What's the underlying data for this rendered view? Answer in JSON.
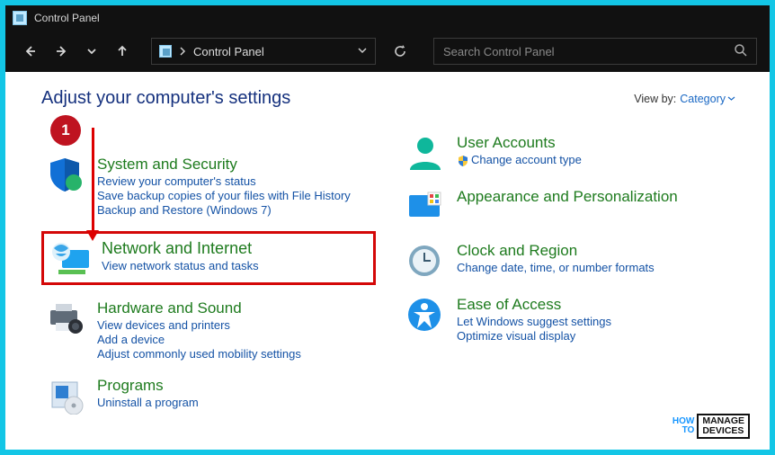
{
  "window": {
    "title": "Control Panel"
  },
  "breadcrumb": {
    "label": "Control Panel"
  },
  "search": {
    "placeholder": "Search Control Panel"
  },
  "heading": "Adjust your computer's settings",
  "viewby": {
    "label": "View by:",
    "value": "Category"
  },
  "step": {
    "badge": "1"
  },
  "left": [
    {
      "title": "System and Security",
      "links": [
        "Review your computer's status",
        "Save backup copies of your files with File History",
        "Backup and Restore (Windows 7)"
      ]
    },
    {
      "title": "Network and Internet",
      "links": [
        "View network status and tasks"
      ]
    },
    {
      "title": "Hardware and Sound",
      "links": [
        "View devices and printers",
        "Add a device",
        "Adjust commonly used mobility settings"
      ]
    },
    {
      "title": "Programs",
      "links": [
        "Uninstall a program"
      ]
    }
  ],
  "right": [
    {
      "title": "User Accounts",
      "links": [
        "Change account type"
      ],
      "shield": true
    },
    {
      "title": "Appearance and Personalization",
      "links": []
    },
    {
      "title": "Clock and Region",
      "links": [
        "Change date, time, or number formats"
      ]
    },
    {
      "title": "Ease of Access",
      "links": [
        "Let Windows suggest settings",
        "Optimize visual display"
      ]
    }
  ],
  "watermark": {
    "line1": "HOW",
    "line2": "TO",
    "box1": "MANAGE",
    "box2": "DEVICES"
  }
}
